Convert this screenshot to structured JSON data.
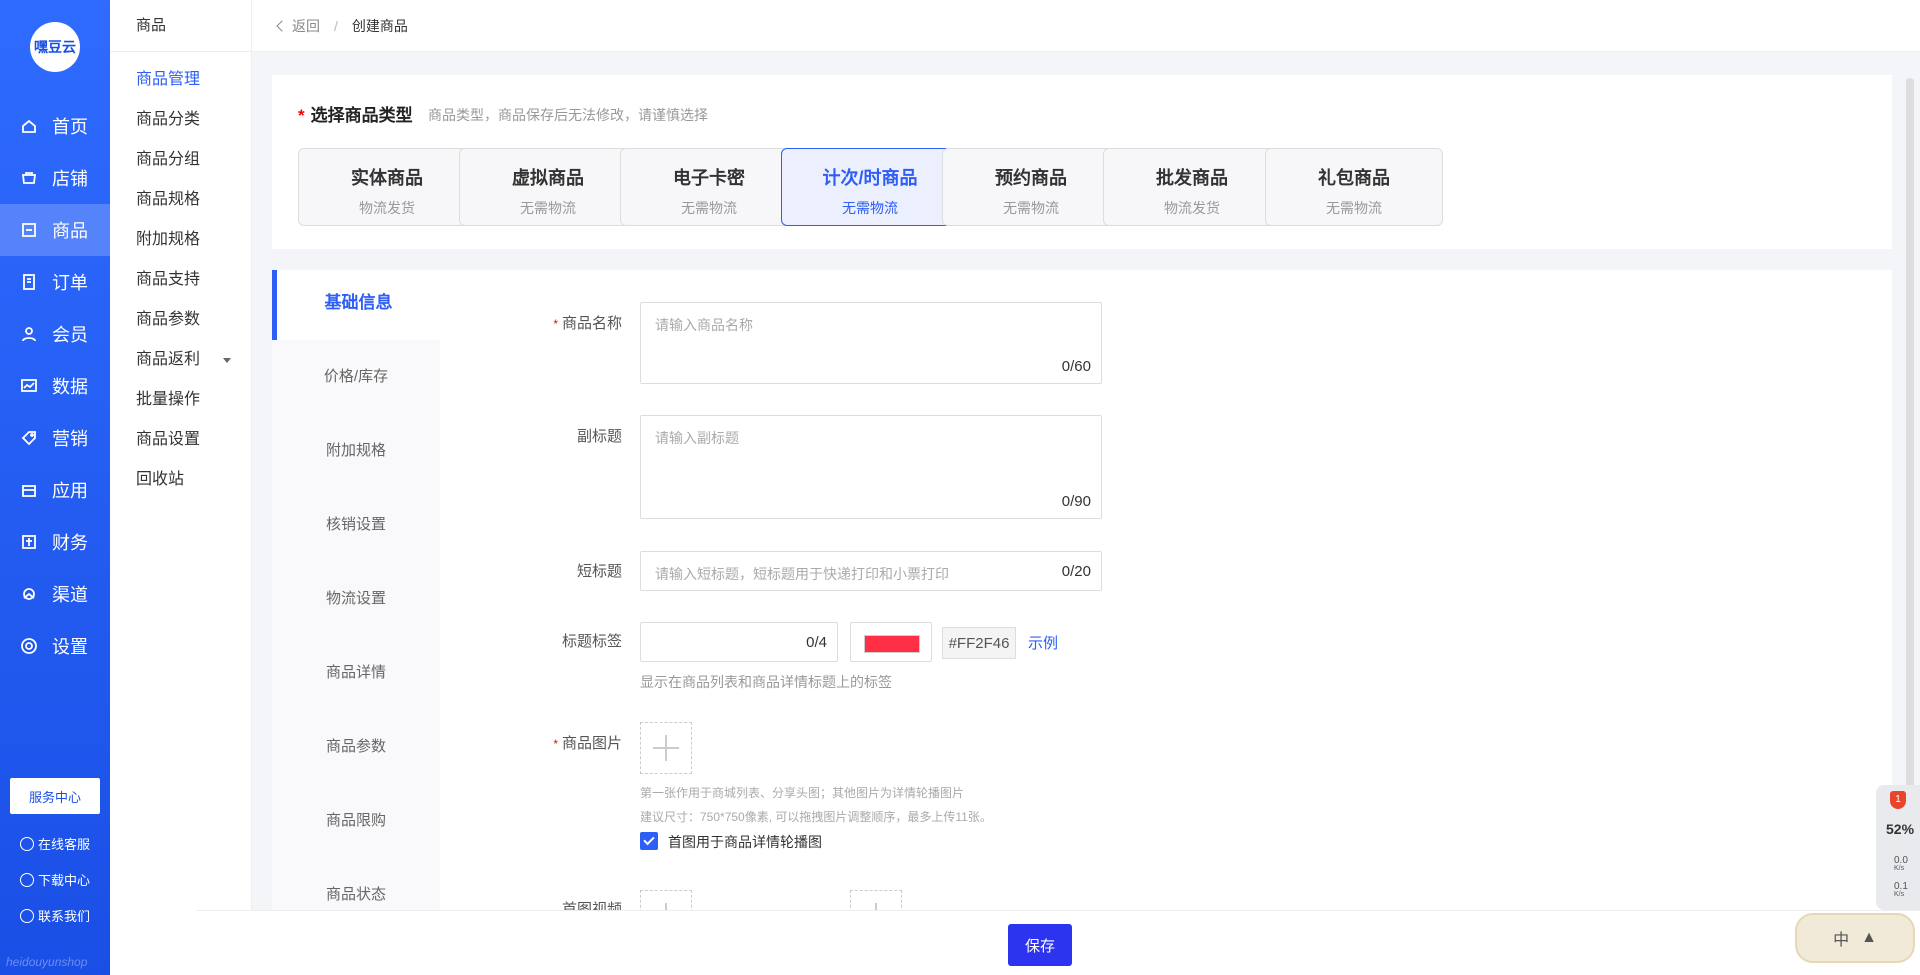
{
  "brand": {
    "logo_text": "嘿豆云",
    "watermark": "heidouyunshop"
  },
  "nav": [
    {
      "label": "首页",
      "icon": "home-icon"
    },
    {
      "label": "店铺",
      "icon": "store-icon"
    },
    {
      "label": "商品",
      "icon": "goods-icon",
      "active": true
    },
    {
      "label": "订单",
      "icon": "order-icon"
    },
    {
      "label": "会员",
      "icon": "member-icon"
    },
    {
      "label": "数据",
      "icon": "chart-icon"
    },
    {
      "label": "营销",
      "icon": "tag-icon"
    },
    {
      "label": "应用",
      "icon": "app-icon"
    },
    {
      "label": "财务",
      "icon": "finance-icon"
    },
    {
      "label": "渠道",
      "icon": "channel-icon"
    },
    {
      "label": "设置",
      "icon": "gear-icon"
    }
  ],
  "side_footer": {
    "service_center": "服务中心",
    "online_service": "在线客服",
    "download_center": "下载中心",
    "contact_us": "联系我们"
  },
  "submenu": {
    "title": "商品",
    "items": [
      "商品管理",
      "商品分类",
      "商品分组",
      "商品规格",
      "附加规格",
      "商品支持",
      "商品参数",
      "商品返利",
      "批量操作",
      "商品设置",
      "回收站"
    ]
  },
  "breadcrumb": {
    "back": "返回",
    "separator": "/",
    "current": "创建商品"
  },
  "type_select": {
    "title": "选择商品类型",
    "hint": "商品类型，商品保存后无法修改，请谨慎选择",
    "options": [
      {
        "name": "实体商品",
        "desc": "物流发货"
      },
      {
        "name": "虚拟商品",
        "desc": "无需物流"
      },
      {
        "name": "电子卡密",
        "desc": "无需物流"
      },
      {
        "name": "计次/时商品",
        "desc": "无需物流",
        "active": true
      },
      {
        "name": "预约商品",
        "desc": "无需物流"
      },
      {
        "name": "批发商品",
        "desc": "物流发货"
      },
      {
        "name": "礼包商品",
        "desc": "无需物流"
      }
    ]
  },
  "tabs": [
    "基础信息",
    "价格/库存",
    "附加规格",
    "核销设置",
    "物流设置",
    "商品详情",
    "商品参数",
    "商品限购",
    "商品状态"
  ],
  "form": {
    "name": {
      "label": "商品名称",
      "placeholder": "请输入商品名称",
      "count": "0/60"
    },
    "subtitle": {
      "label": "副标题",
      "placeholder": "请输入副标题",
      "count": "0/90"
    },
    "short_title": {
      "label": "短标题",
      "placeholder": "请输入短标题，短标题用于快递打印和小票打印",
      "count": "0/20"
    },
    "title_tag": {
      "label": "标题标签",
      "count": "0/4",
      "color": "#FF2F46",
      "color_text": "#FF2F46",
      "example": "示例",
      "hint": "显示在商品列表和商品详情标题上的标签"
    },
    "images": {
      "label": "商品图片",
      "hint1": "第一张作用于商城列表、分享头图；其他图片为详情轮播图片",
      "hint2": "建议尺寸：750*750像素, 可以拖拽图片调整顺序，最多上传11张。",
      "checkbox_label": "首图用于商品详情轮播图"
    },
    "video": {
      "label": "首图视频"
    }
  },
  "footer": {
    "save": "保存"
  },
  "monitor": {
    "badge": "1",
    "cpu": "52%",
    "up": "0.0",
    "down": "0.1",
    "unit": "K/s"
  },
  "ime": {
    "lang": "中"
  }
}
